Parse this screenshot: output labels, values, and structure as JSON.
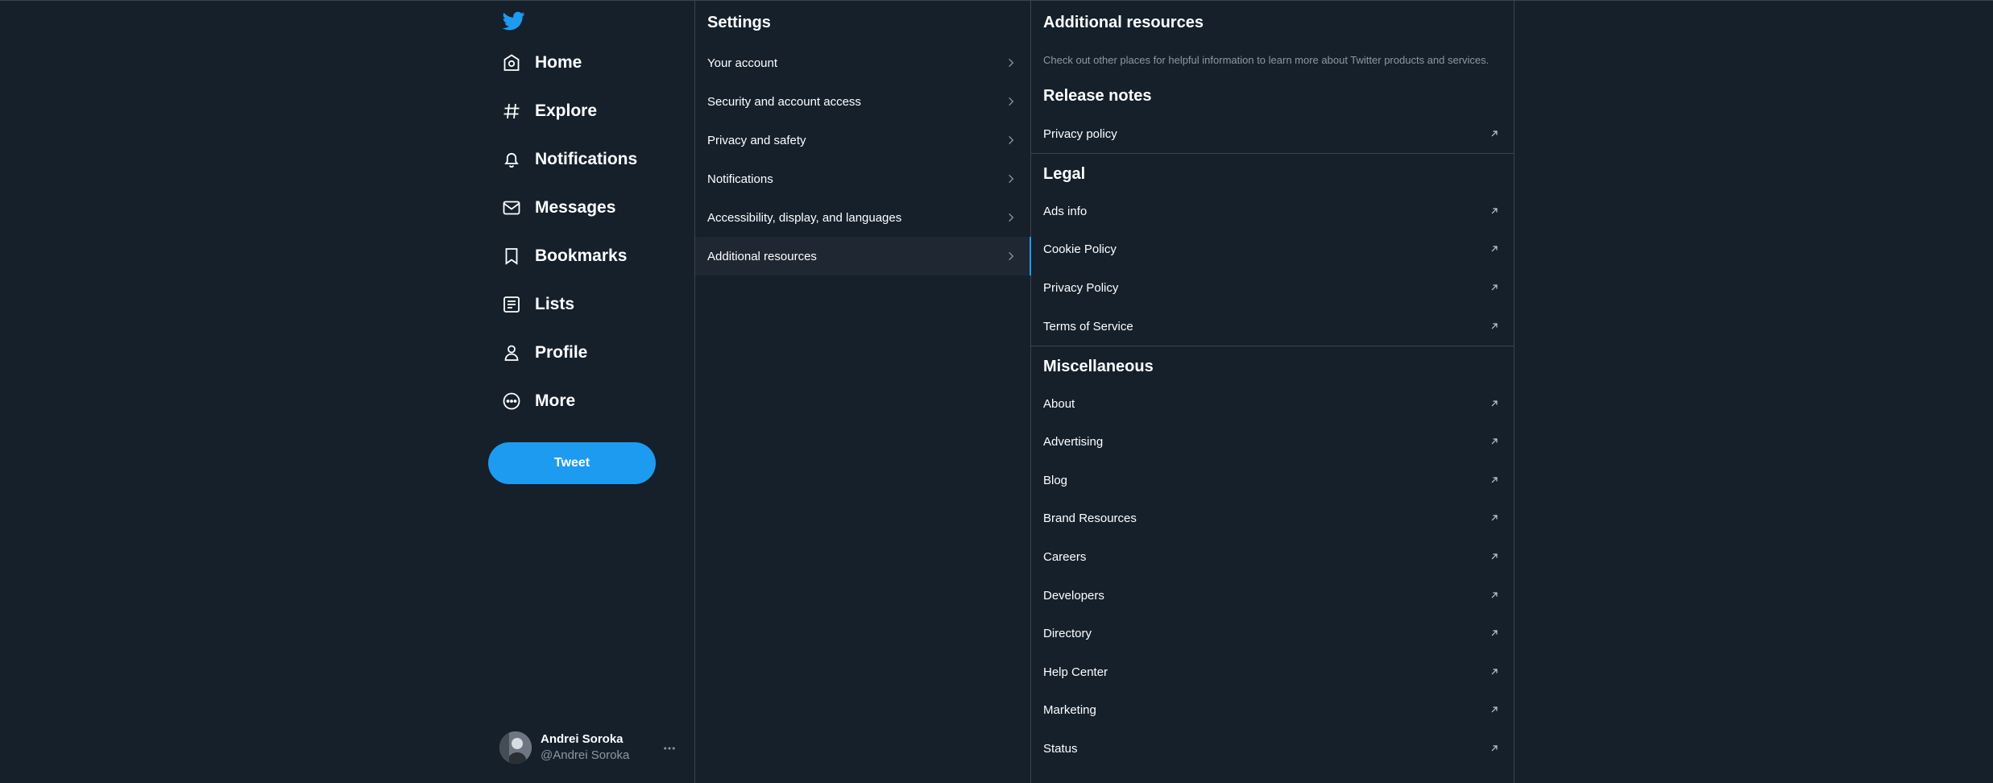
{
  "nav": {
    "items": [
      {
        "label": "Home",
        "icon": "home-icon"
      },
      {
        "label": "Explore",
        "icon": "hashtag-icon"
      },
      {
        "label": "Notifications",
        "icon": "bell-icon"
      },
      {
        "label": "Messages",
        "icon": "mail-icon"
      },
      {
        "label": "Bookmarks",
        "icon": "bookmark-icon"
      },
      {
        "label": "Lists",
        "icon": "list-icon"
      },
      {
        "label": "Profile",
        "icon": "person-icon"
      },
      {
        "label": "More",
        "icon": "more-circle-icon"
      }
    ],
    "tweet_label": "Tweet"
  },
  "account": {
    "name": "Andrei Soroka",
    "handle": "@Andrei Soroka"
  },
  "settings": {
    "title": "Settings",
    "items": [
      {
        "label": "Your account"
      },
      {
        "label": "Security and account access"
      },
      {
        "label": "Privacy and safety"
      },
      {
        "label": "Notifications"
      },
      {
        "label": "Accessibility, display, and languages"
      },
      {
        "label": "Additional resources"
      }
    ],
    "active": "Additional resources"
  },
  "resources": {
    "title": "Additional resources",
    "description": "Check out other places for helpful information to learn more about Twitter products and services.",
    "sections": [
      {
        "heading": "Release notes",
        "items": [
          "Privacy policy"
        ]
      },
      {
        "heading": "Legal",
        "items": [
          "Ads info",
          "Cookie Policy",
          "Privacy Policy",
          "Terms of Service"
        ]
      },
      {
        "heading": "Miscellaneous",
        "items": [
          "About",
          "Advertising",
          "Blog",
          "Brand Resources",
          "Careers",
          "Developers",
          "Directory",
          "Help Center",
          "Marketing",
          "Status"
        ]
      }
    ]
  },
  "colors": {
    "background": "#15202b",
    "accent": "#1d9bf0",
    "border": "#38444d",
    "secondary_text": "#8b98a5",
    "active_row": "#1e2732"
  }
}
